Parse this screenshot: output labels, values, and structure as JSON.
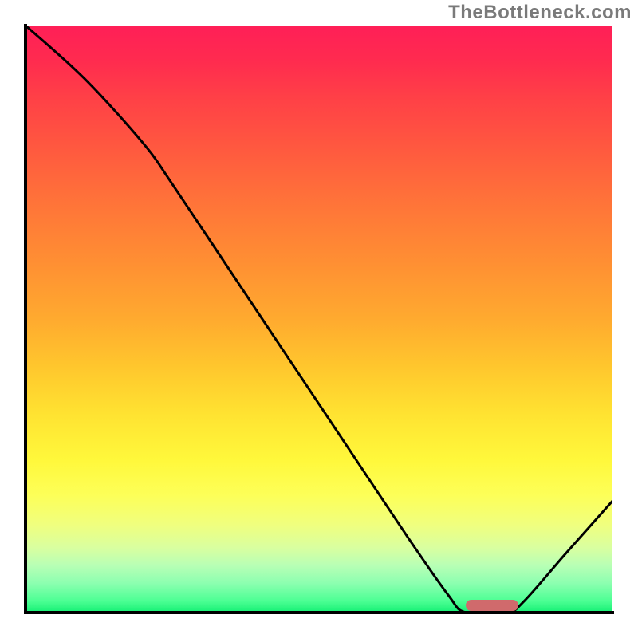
{
  "watermark": "TheBottleneck.com",
  "chart_data": {
    "type": "line",
    "title": "",
    "xlabel": "",
    "ylabel": "",
    "xlim": [
      0,
      100
    ],
    "ylim": [
      0,
      100
    ],
    "grid": false,
    "legend": false,
    "background": "vertical-gradient red→orange→yellow→green",
    "series": [
      {
        "name": "bottleneck-curve",
        "color": "#000000",
        "points": [
          {
            "x": 0,
            "y": 100
          },
          {
            "x": 10,
            "y": 91
          },
          {
            "x": 20,
            "y": 80
          },
          {
            "x": 25,
            "y": 73
          },
          {
            "x": 35,
            "y": 58
          },
          {
            "x": 45,
            "y": 43
          },
          {
            "x": 55,
            "y": 28
          },
          {
            "x": 65,
            "y": 13
          },
          {
            "x": 72,
            "y": 3
          },
          {
            "x": 75,
            "y": 0
          },
          {
            "x": 82,
            "y": 0
          },
          {
            "x": 85,
            "y": 2
          },
          {
            "x": 92,
            "y": 10
          },
          {
            "x": 100,
            "y": 19
          }
        ]
      }
    ],
    "annotations": [
      {
        "name": "optimal-range-marker",
        "type": "bar",
        "x_start": 75,
        "x_end": 84,
        "y": 0,
        "color": "#d06a6c"
      }
    ]
  }
}
